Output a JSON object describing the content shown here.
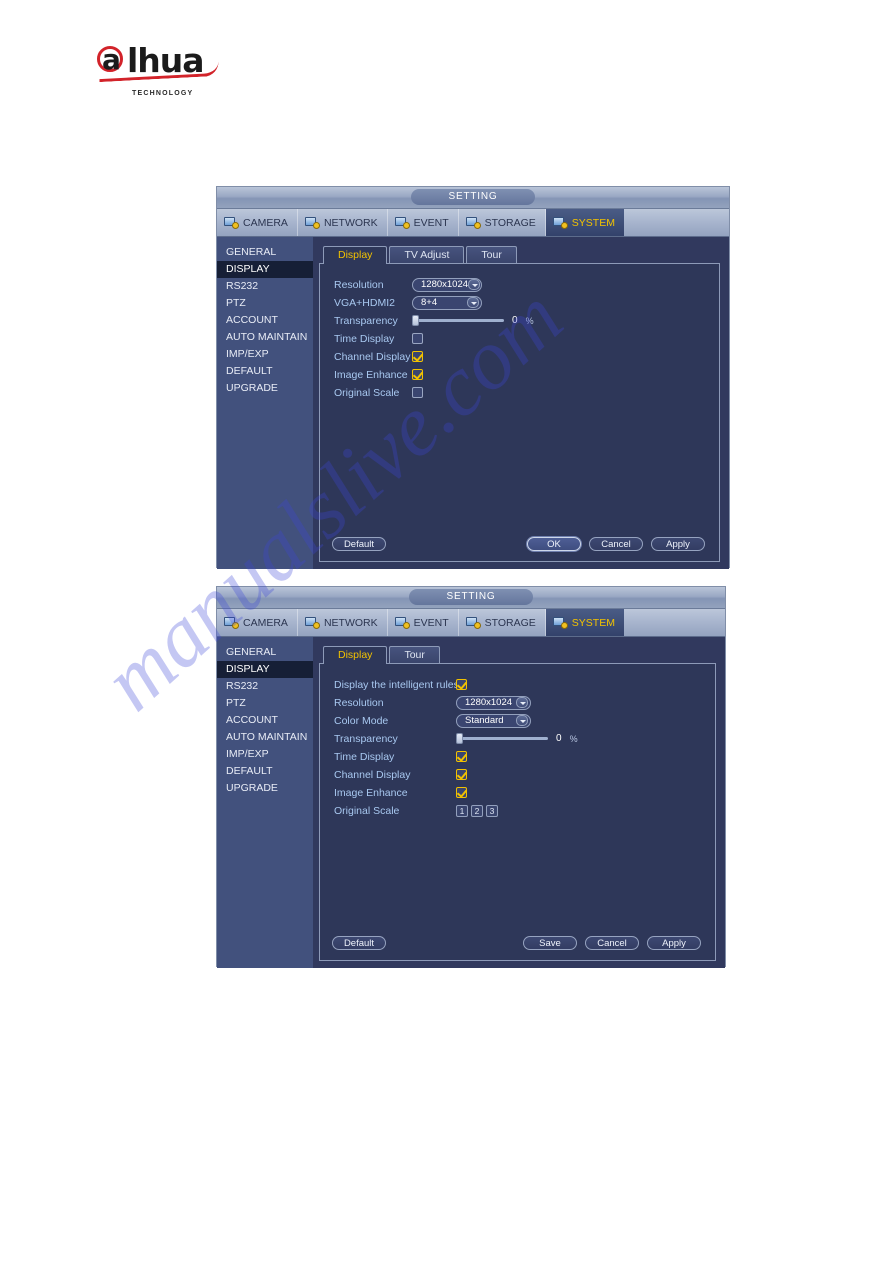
{
  "brand": {
    "logo_text": "alhua",
    "logo_sub": "TECHNOLOGY"
  },
  "watermark": {
    "text": "manualslive.com"
  },
  "dialog1": {
    "title": "SETTING",
    "tabs": [
      {
        "label": "CAMERA",
        "icon": "camera-icon",
        "active": false
      },
      {
        "label": "NETWORK",
        "icon": "network-icon",
        "active": false
      },
      {
        "label": "EVENT",
        "icon": "event-icon",
        "active": false
      },
      {
        "label": "STORAGE",
        "icon": "storage-icon",
        "active": false
      },
      {
        "label": "SYSTEM",
        "icon": "system-icon",
        "active": true
      }
    ],
    "sidebar": [
      {
        "label": "GENERAL",
        "active": false
      },
      {
        "label": "DISPLAY",
        "active": true
      },
      {
        "label": "RS232",
        "active": false
      },
      {
        "label": "PTZ",
        "active": false
      },
      {
        "label": "ACCOUNT",
        "active": false
      },
      {
        "label": "AUTO MAINTAIN",
        "active": false
      },
      {
        "label": "IMP/EXP",
        "active": false
      },
      {
        "label": "DEFAULT",
        "active": false
      },
      {
        "label": "UPGRADE",
        "active": false
      }
    ],
    "subtabs": [
      {
        "label": "Display",
        "active": true
      },
      {
        "label": "TV Adjust",
        "active": false
      },
      {
        "label": "Tour",
        "active": false
      }
    ],
    "fields": {
      "resolution_label": "Resolution",
      "resolution_value": "1280x1024",
      "vga_label": "VGA+HDMI2",
      "vga_value": "8+4",
      "transparency_label": "Transparency",
      "transparency_value": "0",
      "transparency_unit": "%",
      "time_display_label": "Time Display",
      "channel_display_label": "Channel Display",
      "image_enhance_label": "Image Enhance",
      "original_scale_label": "Original Scale"
    },
    "buttons": {
      "default": "Default",
      "ok": "OK",
      "cancel": "Cancel",
      "apply": "Apply"
    }
  },
  "dialog2": {
    "title": "SETTING",
    "tabs": [
      {
        "label": "CAMERA",
        "icon": "camera-icon",
        "active": false
      },
      {
        "label": "NETWORK",
        "icon": "network-icon",
        "active": false
      },
      {
        "label": "EVENT",
        "icon": "event-icon",
        "active": false
      },
      {
        "label": "STORAGE",
        "icon": "storage-icon",
        "active": false
      },
      {
        "label": "SYSTEM",
        "icon": "system-icon",
        "active": true
      }
    ],
    "sidebar": [
      {
        "label": "GENERAL",
        "active": false
      },
      {
        "label": "DISPLAY",
        "active": true
      },
      {
        "label": "RS232",
        "active": false
      },
      {
        "label": "PTZ",
        "active": false
      },
      {
        "label": "ACCOUNT",
        "active": false
      },
      {
        "label": "AUTO MAINTAIN",
        "active": false
      },
      {
        "label": "IMP/EXP",
        "active": false
      },
      {
        "label": "DEFAULT",
        "active": false
      },
      {
        "label": "UPGRADE",
        "active": false
      }
    ],
    "subtabs": [
      {
        "label": "Display",
        "active": true
      },
      {
        "label": "Tour",
        "active": false
      }
    ],
    "fields": {
      "intelligent_rules_label": "Display the intelligent rules",
      "resolution_label": "Resolution",
      "resolution_value": "1280x1024",
      "color_mode_label": "Color Mode",
      "color_mode_value": "Standard",
      "transparency_label": "Transparency",
      "transparency_value": "0",
      "transparency_unit": "%",
      "time_display_label": "Time Display",
      "channel_display_label": "Channel Display",
      "image_enhance_label": "Image Enhance",
      "original_scale_label": "Original Scale",
      "original_scale_options": [
        "1",
        "2",
        "3"
      ]
    },
    "buttons": {
      "default": "Default",
      "save": "Save",
      "cancel": "Cancel",
      "apply": "Apply"
    }
  }
}
